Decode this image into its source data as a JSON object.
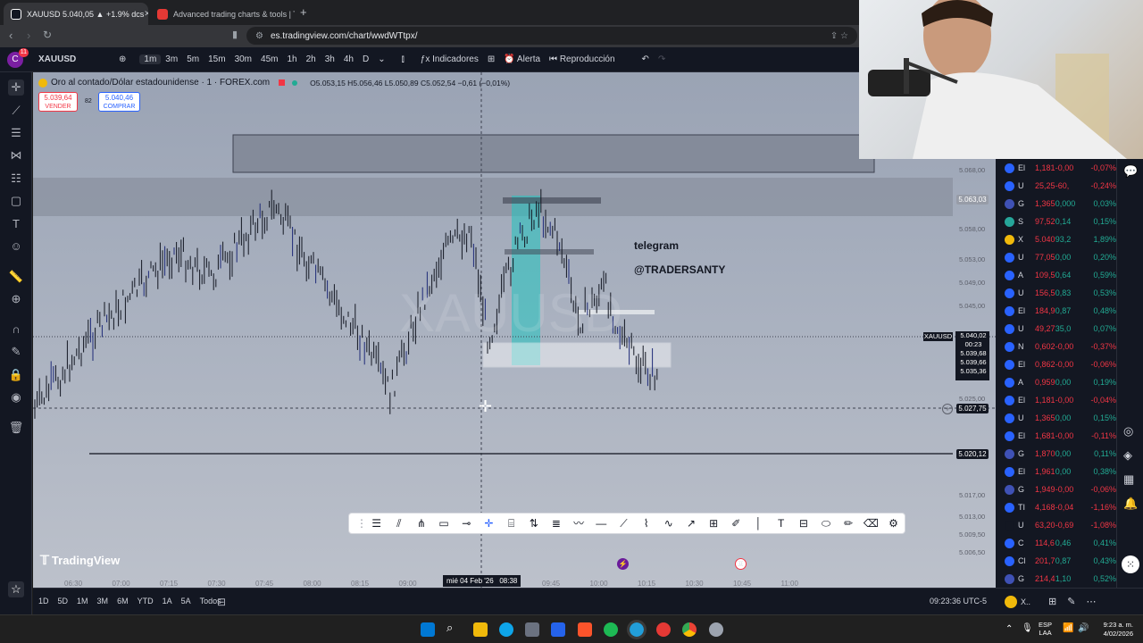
{
  "browser": {
    "tab1_title": "XAUUSD 5.040,05 ▲ +1.9% dcs",
    "tab2_title": "Advanced trading charts & tools | Tra",
    "url": "es.tradingview.com/chart/wwdWTtpx/"
  },
  "toolbar": {
    "symbol": "XAUUSD",
    "avatar_badge": "11",
    "intervals": [
      "1m",
      "3m",
      "5m",
      "15m",
      "30m",
      "45m",
      "1h",
      "2h",
      "3h",
      "4h",
      "D"
    ],
    "active_interval": "1m",
    "indicators_label": "Indicadores",
    "alert_label": "Alerta",
    "replay_label": "Reproducción"
  },
  "chart": {
    "title": "Oro al contado/Dólar estadounidense · 1 · FOREX.com",
    "ohlc": "O5.053,15 H5.056,46 L5.050,89 C5.052,54 −0,61 (−0,01%)",
    "sell_price": "5.039,64",
    "sell_label": "VENDER",
    "spread": "82",
    "buy_price": "5.040,46",
    "buy_label": "COMPRAR",
    "watermark": "XAUUSD",
    "annotation1": "telegram",
    "annotation2": "@TRADERSANTY",
    "logo_text": "TradingView",
    "price_labels": {
      "top_zone": "5.063,03",
      "symbol_tag": "XAUUSD",
      "current": "5.040,02",
      "countdown": "00:23",
      "p1": "5.039,68",
      "p2": "5.039,66",
      "p3": "5.035,36",
      "crosshair": "5.027,75",
      "hline": "5.020,12"
    },
    "axis_ticks": [
      "5.068,00",
      "5.058,00",
      "5.053,00",
      "5.049,00",
      "5.045,00",
      "5.025,00",
      "5.017,00",
      "5.013,00",
      "5.009,50",
      "5.006,50",
      "5.003,50"
    ],
    "time_ticks": [
      "06:30",
      "07:00",
      "07:15",
      "07:30",
      "07:45",
      "08:00",
      "08:15",
      "09:00",
      "09:15",
      "09:30",
      "09:45",
      "10:00",
      "10:15",
      "10:30",
      "10:45",
      "11:00"
    ],
    "crosshair_time": "mié 04 Feb '26   08:38"
  },
  "bottom": {
    "ranges": [
      "1D",
      "5D",
      "1M",
      "3M",
      "6M",
      "YTD",
      "1A",
      "5A",
      "Todos"
    ],
    "clock": "09:23:36 UTC-5"
  },
  "watchlist": [
    {
      "sym": "El",
      "last": "1,181",
      "chg": "-0,00",
      "pct": "-0,07%",
      "dir": "dn",
      "icon": "#2962ff"
    },
    {
      "sym": "U",
      "last": "25,25",
      "chg": "-60,",
      "pct": "-0,24%",
      "dir": "dn",
      "icon": "#2962ff"
    },
    {
      "sym": "G",
      "last": "1,365",
      "chg": "0,000",
      "pct": "0,03%",
      "dir": "up",
      "icon": "#3f51b5"
    },
    {
      "sym": "S",
      "last": "97,52",
      "chg": "0,14",
      "pct": "0,15%",
      "dir": "up",
      "icon": "#26a69a"
    },
    {
      "sym": "X",
      "last": "5.040",
      "chg": "93,2",
      "pct": "1,89%",
      "dir": "up",
      "icon": "#f0b90b"
    },
    {
      "sym": "U",
      "last": "77,05",
      "chg": "0,00",
      "pct": "0,20%",
      "dir": "up",
      "icon": "#2962ff"
    },
    {
      "sym": "A",
      "last": "109,5",
      "chg": "0,64",
      "pct": "0,59%",
      "dir": "up",
      "icon": "#2962ff"
    },
    {
      "sym": "U",
      "last": "156,5",
      "chg": "0,83",
      "pct": "0,53%",
      "dir": "up",
      "icon": "#2962ff"
    },
    {
      "sym": "El",
      "last": "184,9",
      "chg": "0,87",
      "pct": "0,48%",
      "dir": "up",
      "icon": "#2962ff"
    },
    {
      "sym": "U",
      "last": "49,27",
      "chg": "35,0",
      "pct": "0,07%",
      "dir": "up",
      "icon": "#2962ff"
    },
    {
      "sym": "N",
      "last": "0,602",
      "chg": "-0,00",
      "pct": "-0,37%",
      "dir": "dn",
      "icon": "#2962ff"
    },
    {
      "sym": "El",
      "last": "0,862",
      "chg": "-0,00",
      "pct": "-0,06%",
      "dir": "dn",
      "icon": "#2962ff"
    },
    {
      "sym": "A",
      "last": "0,959",
      "chg": "0,00",
      "pct": "0,19%",
      "dir": "up",
      "icon": "#2962ff"
    },
    {
      "sym": "El",
      "last": "1,181",
      "chg": "-0,00",
      "pct": "-0,04%",
      "dir": "dn",
      "icon": "#2962ff"
    },
    {
      "sym": "U",
      "last": "1,365",
      "chg": "0,00",
      "pct": "0,15%",
      "dir": "up",
      "icon": "#2962ff"
    },
    {
      "sym": "El",
      "last": "1,681",
      "chg": "-0,00",
      "pct": "-0,11%",
      "dir": "dn",
      "icon": "#2962ff"
    },
    {
      "sym": "G",
      "last": "1,870",
      "chg": "0,00",
      "pct": "0,11%",
      "dir": "up",
      "icon": "#3f51b5"
    },
    {
      "sym": "El",
      "last": "1,961",
      "chg": "0,00",
      "pct": "0,38%",
      "dir": "up",
      "icon": "#2962ff"
    },
    {
      "sym": "G",
      "last": "1,949",
      "chg": "-0,00",
      "pct": "-0,06%",
      "dir": "dn",
      "icon": "#3f51b5"
    },
    {
      "sym": "TI",
      "last": "4,168",
      "chg": "-0,04",
      "pct": "-1,16%",
      "dir": "dn",
      "icon": "#2962ff"
    },
    {
      "sym": "U",
      "last": "63,20",
      "chg": "-0,69",
      "pct": "-1,08%",
      "dir": "dn",
      "icon": "#131722"
    },
    {
      "sym": "C",
      "last": "114,6",
      "chg": "0,46",
      "pct": "0,41%",
      "dir": "up",
      "icon": "#2962ff"
    },
    {
      "sym": "Cl",
      "last": "201,7",
      "chg": "0,87",
      "pct": "0,43%",
      "dir": "up",
      "icon": "#2962ff"
    },
    {
      "sym": "G",
      "last": "214,4",
      "chg": "1,10",
      "pct": "0,52%",
      "dir": "up",
      "icon": "#3f51b5"
    }
  ],
  "taskbar": {
    "lang1": "ESP",
    "lang2": "LAA",
    "time": "9:23 a. m.",
    "date": "4/02/2026"
  },
  "colors": {
    "up": "#22ab94",
    "down": "#f23645",
    "accent": "#2962ff"
  }
}
